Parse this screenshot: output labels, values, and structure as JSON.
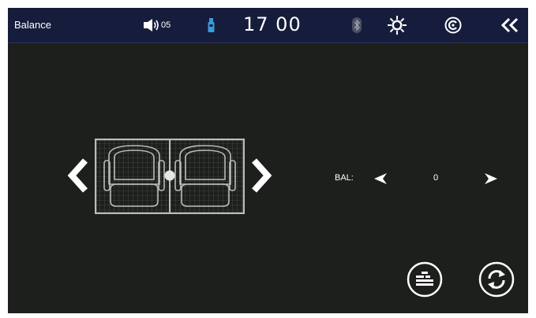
{
  "header": {
    "title": "Balance",
    "volume_level": "05",
    "time": "17 00",
    "icons": {
      "volume": "speaker-icon",
      "usb": "usb-drive-icon",
      "bluetooth": "bluetooth-icon",
      "brightness": "brightness-icon",
      "navigation": "navigation-icon",
      "back": "double-chevron-left-icon"
    }
  },
  "balance": {
    "label": "BAL:",
    "value": "0",
    "level": 0
  },
  "colors": {
    "screen_background": "#1d1f1d",
    "header_background": "#161d3c",
    "foreground": "#ffffff",
    "seat_lines": "#b9bdb7"
  }
}
